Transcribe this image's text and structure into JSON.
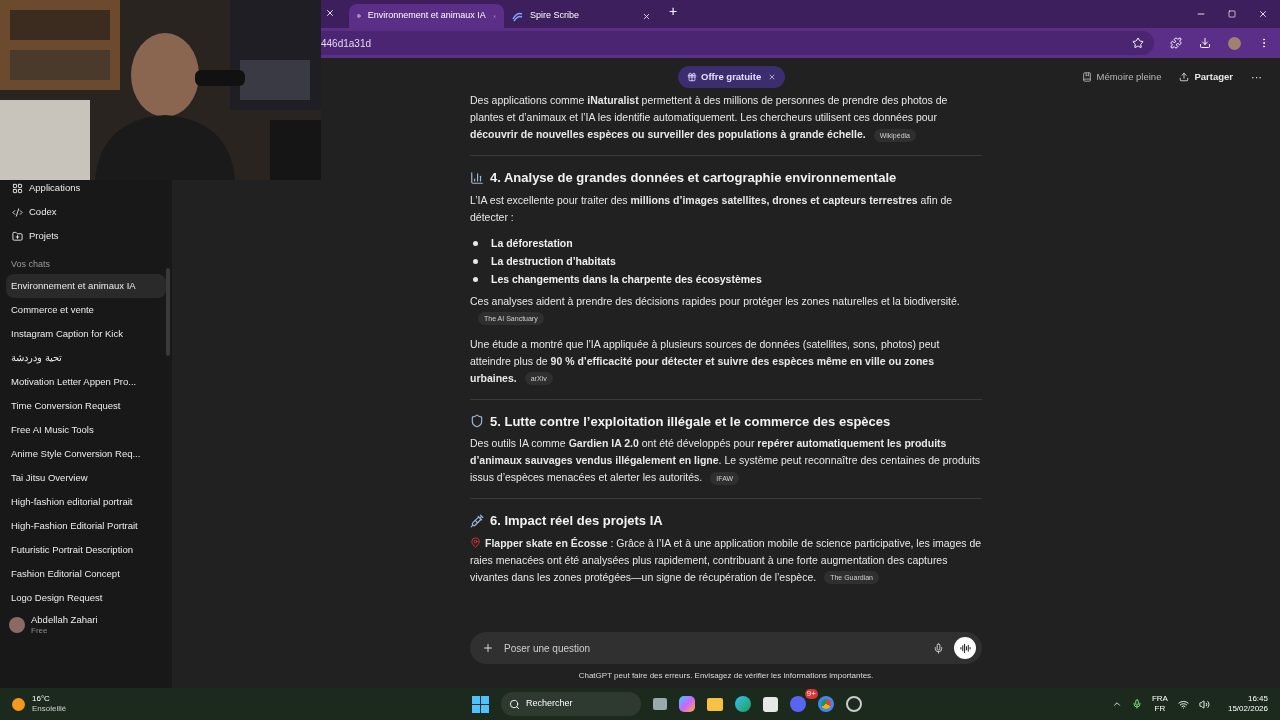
{
  "browser": {
    "tabs": [
      {
        "label": "Environnement et animaux IA",
        "selected": true
      },
      {
        "label": "Spire Scribe",
        "selected": false
      }
    ],
    "new_tab": "+",
    "address": "446d1a31d"
  },
  "sidebar": {
    "nav": [
      "Applications",
      "Codex",
      "Projets"
    ],
    "section": "Vos chats",
    "chats": [
      {
        "label": "Environnement et animaux IA",
        "selected": true
      },
      {
        "label": "Commerce et vente",
        "selected": false
      },
      {
        "label": "Instagram Caption for Kick",
        "selected": false
      },
      {
        "label": "تحية ودردشة",
        "selected": false
      },
      {
        "label": "Motivation Letter Appen Pro...",
        "selected": false
      },
      {
        "label": "Time Conversion Request",
        "selected": false
      },
      {
        "label": "Free AI Music Tools",
        "selected": false
      },
      {
        "label": "Anime Style Conversion Req...",
        "selected": false
      },
      {
        "label": "Tai Jitsu Overview",
        "selected": false
      },
      {
        "label": "High-fashion editorial portrait",
        "selected": false
      },
      {
        "label": "High-Fashion Editorial Portrait",
        "selected": false
      },
      {
        "label": "Futuristic Portrait Description",
        "selected": false
      },
      {
        "label": "Fashion Editorial Concept",
        "selected": false
      },
      {
        "label": "Logo Design Request",
        "selected": false
      }
    ],
    "user": {
      "name": "Abdellah Zahari",
      "plan": "Free"
    }
  },
  "header": {
    "memory": "Mémoire pleine",
    "share": "Partager",
    "more": "···",
    "offer": "Offre gratuite"
  },
  "content": [
    {
      "kind": "paragraph",
      "text": "Des applications comme **iNaturalist** permettent à des millions de personnes de prendre des photos de plantes et d’animaux et l’IA les identifie automatiquement. Les chercheurs utilisent ces données pour **découvrir de nouvelles espèces ou surveiller des populations à grande échelle.**",
      "source": "Wikipédia"
    },
    {
      "kind": "divider"
    },
    {
      "kind": "heading",
      "text": "4. Analyse de grandes données et cartographie environnementale"
    },
    {
      "kind": "paragraph",
      "text": "L’IA est excellente pour traiter des **millions d’images satellites, drones et capteurs terrestres** afin de détecter :"
    },
    {
      "kind": "list",
      "items": [
        "La déforestation",
        "La destruction d’habitats",
        "Les changements dans la charpente des écosystèmes"
      ]
    },
    {
      "kind": "paragraph",
      "text": "Ces analyses aident à prendre des décisions rapides pour protéger les zones naturelles et la biodiversité.",
      "source": "The AI Sanctuary"
    },
    {
      "kind": "paragraph",
      "text": "Une étude a montré que l’IA appliquée à plusieurs sources de données (satellites, sons, photos) peut atteindre plus de **90 % d’efficacité pour détecter et suivre des espèces même en ville ou zones urbaines.**",
      "source": "arXiv"
    },
    {
      "kind": "divider"
    },
    {
      "kind": "heading",
      "text": "5. Lutte contre l’exploitation illégale et le commerce des espèces"
    },
    {
      "kind": "paragraph",
      "text": "Des outils IA comme **Gardien IA 2.0** ont été développés pour **repérer automatiquement les produits d’animaux sauvages vendus illégalement en ligne**. Le système peut reconnaître des centaines de produits issus d’espèces menacées et alerter les autorités.",
      "source": "IFAW"
    },
    {
      "kind": "divider"
    },
    {
      "kind": "heading",
      "text": "6. Impact réel des projets IA"
    },
    {
      "kind": "pinned",
      "text": "**Flapper skate en Écosse** : Grâce à l’IA et à une application mobile de science participative, les images de raies menacées ont été analysées plus rapidement, contribuant à une forte augmentation des captures vivantes dans les zones protégées—un signe de récupération de l’espèce.",
      "source": "The Guardian"
    }
  ],
  "composer": {
    "placeholder": "Poser une question",
    "disclaimer": "ChatGPT peut faire des erreurs. Envisagez de vérifier les informations importantes."
  },
  "taskbar": {
    "temperature": "16°C",
    "weather": "Ensoleillé",
    "search": "Rechercher",
    "badge": "9+",
    "lang": "FRA",
    "layout": "FR",
    "time": "16:45",
    "date": "15/02/2026"
  }
}
